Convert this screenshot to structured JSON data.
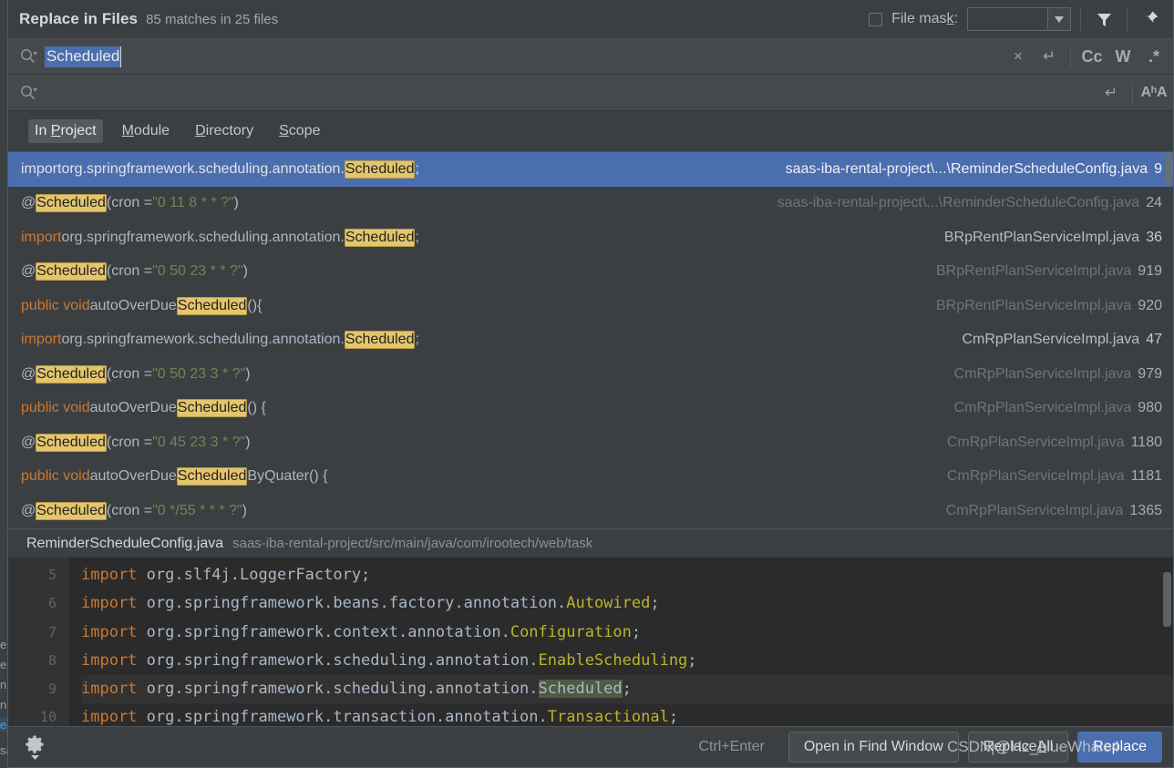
{
  "header": {
    "title": "Replace in Files",
    "match_count": "85 matches in 25 files",
    "file_mask_label_a": "File mas",
    "file_mask_label_k": "k",
    "file_mask_label_b": ":",
    "file_mask_value": "",
    "filter_icon": "funnel-icon",
    "pin_icon": "pin-icon",
    "dropdown_icon": "chevron-down-icon"
  },
  "search": {
    "value": "Scheduled",
    "magnifier_icon": "search-icon",
    "clear_label": "×",
    "newline_label": "↵",
    "case_label": "Cc",
    "words_label": "W",
    "regex_label": ".*"
  },
  "replace": {
    "value": "",
    "placeholder": "",
    "magnifier_icon": "search-icon",
    "newline_label": "↵",
    "preserve_case_label": "AʰA"
  },
  "scope": {
    "tabs": [
      {
        "pre": "In ",
        "accel": "P",
        "post": "roject",
        "active": true
      },
      {
        "pre": "",
        "accel": "M",
        "post": "odule",
        "active": false
      },
      {
        "pre": "",
        "accel": "D",
        "post": "irectory",
        "active": false
      },
      {
        "pre": "",
        "accel": "S",
        "post": "cope",
        "active": false
      }
    ]
  },
  "results": [
    {
      "selected": true,
      "segments": [
        {
          "t": "import ",
          "c": "dim"
        },
        {
          "t": "org.springframework.scheduling.annotation.",
          "c": "plain"
        },
        {
          "t": "Scheduled",
          "c": "hl"
        },
        {
          "t": ";",
          "c": "plain"
        }
      ],
      "file": "saas-iba-rental-project\\...\\ReminderScheduleConfig.java",
      "line": "9",
      "faded": false
    },
    {
      "selected": false,
      "segments": [
        {
          "t": "@",
          "c": "plain"
        },
        {
          "t": "Scheduled",
          "c": "hl"
        },
        {
          "t": "(cron = ",
          "c": "plain"
        },
        {
          "t": "\"0 11 8 * * ?\"",
          "c": "str"
        },
        {
          "t": ")",
          "c": "plain"
        }
      ],
      "file": "saas-iba-rental-project\\...\\ReminderScheduleConfig.java",
      "line": "24",
      "faded": true
    },
    {
      "selected": false,
      "segments": [
        {
          "t": "import ",
          "c": "kw"
        },
        {
          "t": "org.springframework.scheduling.annotation.",
          "c": "plain"
        },
        {
          "t": "Scheduled",
          "c": "hl"
        },
        {
          "t": ";",
          "c": "plain"
        }
      ],
      "file": "BRpRentPlanServiceImpl.java",
      "line": "36",
      "faded": false
    },
    {
      "selected": false,
      "segments": [
        {
          "t": "@",
          "c": "plain"
        },
        {
          "t": "Scheduled",
          "c": "hl"
        },
        {
          "t": "(cron = ",
          "c": "plain"
        },
        {
          "t": "\"0 50 23 * * ?\"",
          "c": "str"
        },
        {
          "t": ")",
          "c": "plain"
        }
      ],
      "file": "BRpRentPlanServiceImpl.java",
      "line": "919",
      "faded": true
    },
    {
      "selected": false,
      "segments": [
        {
          "t": "public void ",
          "c": "kw"
        },
        {
          "t": "autoOverDue",
          "c": "plain"
        },
        {
          "t": "Scheduled",
          "c": "hl"
        },
        {
          "t": "(){",
          "c": "plain"
        }
      ],
      "file": "BRpRentPlanServiceImpl.java",
      "line": "920",
      "faded": true
    },
    {
      "selected": false,
      "segments": [
        {
          "t": "import ",
          "c": "kw"
        },
        {
          "t": "org.springframework.scheduling.annotation.",
          "c": "plain"
        },
        {
          "t": "Scheduled",
          "c": "hl"
        },
        {
          "t": ";",
          "c": "plain"
        }
      ],
      "file": "CmRpPlanServiceImpl.java",
      "line": "47",
      "faded": false
    },
    {
      "selected": false,
      "segments": [
        {
          "t": "@",
          "c": "plain"
        },
        {
          "t": "Scheduled",
          "c": "hl"
        },
        {
          "t": "(cron = ",
          "c": "plain"
        },
        {
          "t": "\"0 50 23 3 * ?\"",
          "c": "str"
        },
        {
          "t": ")",
          "c": "plain"
        }
      ],
      "file": "CmRpPlanServiceImpl.java",
      "line": "979",
      "faded": true
    },
    {
      "selected": false,
      "segments": [
        {
          "t": "public void ",
          "c": "kw"
        },
        {
          "t": "autoOverDue",
          "c": "plain"
        },
        {
          "t": "Scheduled",
          "c": "hl"
        },
        {
          "t": "() {",
          "c": "plain"
        }
      ],
      "file": "CmRpPlanServiceImpl.java",
      "line": "980",
      "faded": true
    },
    {
      "selected": false,
      "segments": [
        {
          "t": "@",
          "c": "plain"
        },
        {
          "t": "Scheduled",
          "c": "hl"
        },
        {
          "t": "(cron = ",
          "c": "plain"
        },
        {
          "t": "\"0 45 23 3 * ?\"",
          "c": "str"
        },
        {
          "t": ")",
          "c": "plain"
        }
      ],
      "file": "CmRpPlanServiceImpl.java",
      "line": "1180",
      "faded": true
    },
    {
      "selected": false,
      "segments": [
        {
          "t": "public void ",
          "c": "kw"
        },
        {
          "t": "autoOverDue",
          "c": "plain"
        },
        {
          "t": "Scheduled",
          "c": "hl"
        },
        {
          "t": "ByQuater() {",
          "c": "plain"
        }
      ],
      "file": "CmRpPlanServiceImpl.java",
      "line": "1181",
      "faded": true
    },
    {
      "selected": false,
      "segments": [
        {
          "t": "@",
          "c": "plain"
        },
        {
          "t": "Scheduled",
          "c": "hl"
        },
        {
          "t": "(cron = ",
          "c": "plain"
        },
        {
          "t": "\"0 */55 * * * ?\"",
          "c": "str"
        },
        {
          "t": ")",
          "c": "plain"
        }
      ],
      "file": "CmRpPlanServiceImpl.java",
      "line": "1365",
      "faded": true
    }
  ],
  "badge": {
    "icon": "search-icon",
    "color": "#dd2c2c"
  },
  "preview": {
    "file_name": "ReminderScheduleConfig.java",
    "path": "saas-iba-rental-project/src/main/java/com/irootech/web/task",
    "lines": [
      {
        "no": "5",
        "highlight": false,
        "segments": [
          {
            "t": "import ",
            "c": "kw"
          },
          {
            "t": "org.slf4j.LoggerFactory;",
            "c": "plain"
          }
        ]
      },
      {
        "no": "6",
        "highlight": false,
        "segments": [
          {
            "t": "import ",
            "c": "kw"
          },
          {
            "t": "org.springframework.beans.factory.annotation.",
            "c": "plain"
          },
          {
            "t": "Autowired",
            "c": "type"
          },
          {
            "t": ";",
            "c": "plain"
          }
        ]
      },
      {
        "no": "7",
        "highlight": false,
        "segments": [
          {
            "t": "import ",
            "c": "kw"
          },
          {
            "t": "org.springframework.context.annotation.",
            "c": "plain"
          },
          {
            "t": "Configuration",
            "c": "type"
          },
          {
            "t": ";",
            "c": "plain"
          }
        ]
      },
      {
        "no": "8",
        "highlight": false,
        "segments": [
          {
            "t": "import ",
            "c": "kw"
          },
          {
            "t": "org.springframework.scheduling.annotation.",
            "c": "plain"
          },
          {
            "t": "EnableScheduling",
            "c": "type"
          },
          {
            "t": ";",
            "c": "plain"
          }
        ]
      },
      {
        "no": "9",
        "highlight": true,
        "segments": [
          {
            "t": "import ",
            "c": "kw"
          },
          {
            "t": "org.springframework.scheduling.annotation.",
            "c": "plain"
          },
          {
            "t": "Scheduled",
            "c": "match"
          },
          {
            "t": ";",
            "c": "plain"
          }
        ]
      },
      {
        "no": "10",
        "highlight": false,
        "segments": [
          {
            "t": "import ",
            "c": "kw"
          },
          {
            "t": "org.springframework.transaction.annotation.",
            "c": "plain"
          },
          {
            "t": "Transactional",
            "c": "type"
          },
          {
            "t": ";",
            "c": "plain"
          }
        ]
      }
    ]
  },
  "footer": {
    "gear_icon": "gear-icon",
    "shortcut": "Ctrl+Enter",
    "open_in_find_window": "Open in Find Window",
    "replace_all_pre": "Replace ",
    "replace_all_accel": "A",
    "replace_all_post": "ll",
    "replace": "Replace"
  },
  "watermark": "CSDN|@Hz_blueWhale4",
  "background_ide": {
    "left_strip": [
      "e",
      "e",
      "n",
      "ne",
      "ec",
      "sa"
    ]
  }
}
